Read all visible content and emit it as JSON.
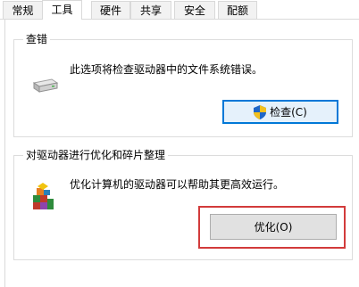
{
  "tabs": [
    {
      "label": "常规",
      "active": false
    },
    {
      "label": "工具",
      "active": true
    },
    {
      "label": "硬件",
      "active": false
    },
    {
      "label": "共享",
      "active": false
    },
    {
      "label": "安全",
      "active": false
    },
    {
      "label": "配额",
      "active": false
    }
  ],
  "error_check": {
    "title": "查错",
    "description": "此选项将检查驱动器中的文件系统错误。",
    "button_label": "检查(C)",
    "drive_icon": "drive-icon",
    "shield_icon": "shield-icon"
  },
  "optimize": {
    "title": "对驱动器进行优化和碎片整理",
    "description": "优化计算机的驱动器可以帮助其更高效运行。",
    "button_label": "优化(O)",
    "defrag_icon": "defrag-icon"
  },
  "colors": {
    "focus_blue": "#0078d7",
    "highlight_red": "#d23b3b"
  }
}
